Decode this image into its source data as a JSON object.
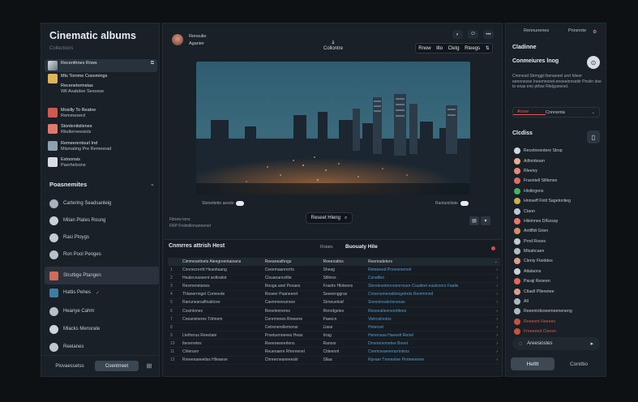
{
  "left": {
    "title": "Cinematic albums",
    "subtitle": "Collections",
    "albums": [
      {
        "line1": "Recenthnes Rows",
        "line2": "",
        "color": "#c7cdd4",
        "active": true
      },
      {
        "line1": "Mts Tomme Cosomings",
        "line2": "",
        "color": "#e0b45a"
      },
      {
        "line1": "Recenetorinstas",
        "line2": "Wll Avabdee Sesosse",
        "color": ""
      },
      {
        "line1": "Mosilly To Reatne",
        "line2": "Remmeserd",
        "color": "#d4584e"
      },
      {
        "line1": "Stonlenitsilenes",
        "line2": "Riiutlerneesiols",
        "color": "#e07a6e"
      },
      {
        "line1": "Remeerentsurl Ind",
        "line2": "Mismating Pre Remeerad",
        "color": "#8fa0ae"
      },
      {
        "line1": "Extoonsis",
        "line2": "Paerhelsons",
        "color": "#d8dde2"
      }
    ],
    "section_title": "Poasnemites",
    "playlists": [
      {
        "label": "Cartering Seadsanleig",
        "color": "#a7b2bc"
      },
      {
        "label": "Mitan Plates Roung",
        "color": "#c9d0d6"
      },
      {
        "label": "Rasi Ptoygs",
        "color": "#c4ccd2"
      },
      {
        "label": "Ron Pool Penges",
        "color": "#b9c2ca"
      },
      {
        "label": "Strutbge Ptangen",
        "color": "#d46a58",
        "active": true
      },
      {
        "label": "Hattis Pehes",
        "color": "#3f7d9c",
        "badge": "✓"
      },
      {
        "label": "Heanye Cahm",
        "color": "#b8c0c8"
      },
      {
        "label": "Mlacks Mensrate",
        "color": "#ced5db"
      },
      {
        "label": "Reelanes",
        "color": "#bfc7ce"
      }
    ],
    "footer": {
      "a": "Plovaessetss",
      "b": "Coentrreet",
      "c": "⊞"
    }
  },
  "center": {
    "user_name": "Rensulie",
    "user_sub": "Aganier",
    "mid_label": "Collontre",
    "toolbar_icons": [
      "◐",
      "⬭",
      "•••"
    ],
    "toolbar_group": [
      "Rnow",
      "Ilto",
      "Cletg",
      "Rteegs",
      "⇅"
    ],
    "caption_left": "Stenettetto aeodo",
    "caption_right": "Rantanitilate",
    "meta_line1": "Fitnew tons",
    "meta_line2": "FRP Frolmilinnannenor",
    "search_label": "Reseet Hleng",
    "view_buttons": [
      "▤",
      "▾"
    ],
    "table": {
      "title": "Cnmrres attrish Hest",
      "tab1": "Rstats",
      "tab2": "Buouaty Hile",
      "columns": [
        "Cimmeantnets Aleegreentaioans",
        "Reeaneathngs",
        "Reeenatins",
        "Reemadeters"
      ],
      "rows": [
        [
          "1",
          "Cnnnecrerrtt Heanitaang",
          "Ceeemaanrerrts",
          "Sheag",
          "Reteweed Prevsenenrel"
        ],
        [
          "2",
          "Healecnaseent ardtraitot",
          "Clsuananceltte",
          "Stllines",
          "Csnatfeo"
        ],
        [
          "3",
          "Resmenetanes",
          "Reoga anel Pesaes",
          "Fraelrs Hloteens",
          "Sleretesetennnenrreare Craafeet eaaloonrs Faaile"
        ],
        [
          "4",
          "Thlanernngel Comeede",
          "Reseer Paaneeret",
          "Seeeenggras",
          "Cnnenomenatiiongetrets Remmmnd"
        ],
        [
          "5",
          "Ranuneanaifinatiicee",
          "Caemmeeurrsee",
          "Sirneueleaf",
          "Snesotrealerienseas"
        ],
        [
          "6",
          "Cosintones",
          "Reeelenneres",
          "Rerodgeies",
          "Resoeatieeneertitees"
        ],
        [
          "7",
          "Cneanimeres Tdrinem",
          "Ceremnnes Rneeere",
          "Paeecn",
          "Vlelrcelnotos"
        ],
        [
          "8",
          "",
          "Cetrenerellemonsr",
          "Llase",
          "Hntersot"
        ],
        [
          "9",
          "Ltetherus Reeetaie",
          "Prsetuenneees Heas",
          "Irrag",
          "Henensaa Haeeelt Rertel"
        ],
        [
          "10",
          "Ilenerretes",
          "Reeeneeeerlens",
          "Ranoor",
          "Drnerenemetee Bneet"
        ],
        [
          "11",
          "Chlenanr",
          "Reuenaere Rhereenel",
          "Ctiteennl",
          "Cnemoeaenerarrintess"
        ],
        [
          "12",
          "Rreeenaeeeliss Hlieaese",
          "Chreerneaneeesiir",
          "Sllaa",
          "Rpvaer Tnereetee Pnrteerenne"
        ]
      ]
    }
  },
  "right": {
    "top_a": "Rennunenes",
    "top_b": "Pnrsnnte",
    "heading1": "Cladinne",
    "heading2": "Conmeiures lnog",
    "description": "Cnnnesd Strmggt thenaneel unrt hlieer eennnesse Ineemnonel-enoeeinnsetiir Pnoiln doe to enas eno pthse Rtelgunenel.",
    "tabs": [
      "Arcee",
      "Cnnnenta",
      "⌄"
    ],
    "heading3": "Clcdiss",
    "items": [
      {
        "label": "Recetnnentere Strsp",
        "color": "#d3d9df"
      },
      {
        "label": "Ailhmtteam",
        "color": "#e7b08c"
      },
      {
        "label": "Rleeivy",
        "color": "#e58a78"
      },
      {
        "label": "Fraontell Silltenes",
        "color": "#e26c5a"
      },
      {
        "label": "Hlotlirgons",
        "color": "#4ab062"
      },
      {
        "label": "Hnnseff Fintl Sagetonlieg",
        "color": "#c7b04e"
      },
      {
        "label": "Ctaon",
        "color": "#bfc8d0"
      },
      {
        "label": "Hileinnes D/Eesay",
        "color": "#e7786a"
      },
      {
        "label": "Antlffdt Grien",
        "color": "#d88b68"
      },
      {
        "label": "Prnd Roses",
        "color": "#c2cad2"
      },
      {
        "label": "Mtsahcaen",
        "color": "#b3bdc6"
      },
      {
        "label": "Cleniy Fteiddes",
        "color": "#de9e86"
      },
      {
        "label": "Atlalaons",
        "color": "#cbd2d8"
      },
      {
        "label": "Paraji Reseen",
        "color": "#e3685a"
      },
      {
        "label": "Ctlaell Pllenetee",
        "color": "#d7a089"
      },
      {
        "label": "All",
        "color": "#aeb8c2"
      },
      {
        "label": "Reeenirdsoeemeeneneng",
        "color": "#aeb8c2"
      },
      {
        "label": "Reeeent Heeeen",
        "color": "#c9513f",
        "red": true
      },
      {
        "label": "Freeeeed Cleeen",
        "color": "#c9513f",
        "red": true
      }
    ],
    "action_label": "Areesiostes",
    "button_a": "Helltt",
    "button_b": "Conittio"
  }
}
